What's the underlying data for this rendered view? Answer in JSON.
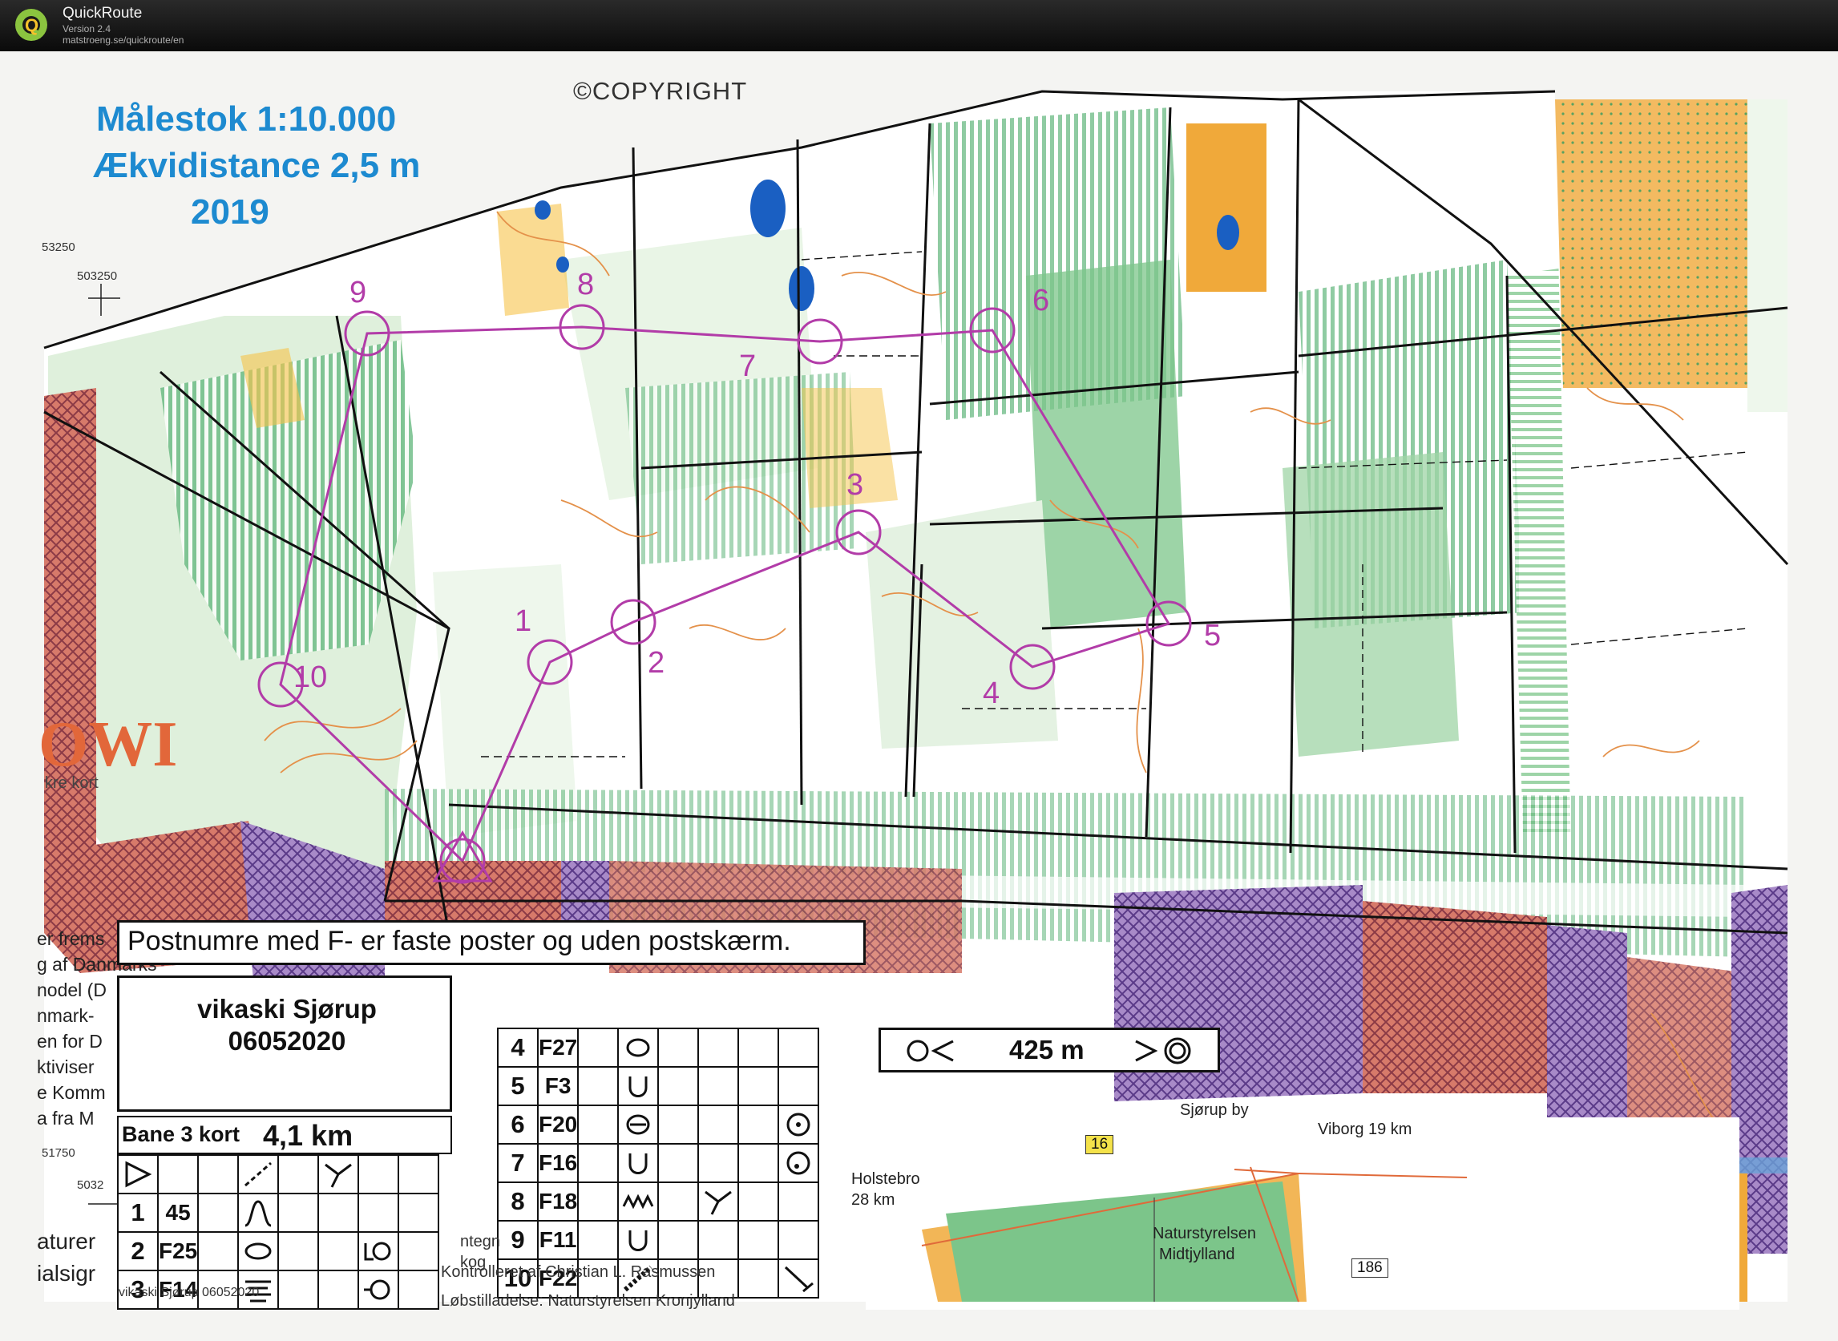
{
  "app": {
    "title": "QuickRoute",
    "version": "Version 2.4",
    "url": "matstroeng.se/quickroute/en"
  },
  "map": {
    "header": {
      "scale": "Målestok 1:10.000",
      "equidistance": "Ækvidistance 2,5 m",
      "year": "2019"
    },
    "copyright": "©COPYRIGHT",
    "coord_top_left_a": "53250",
    "coord_top_left_b": "503250",
    "coord_bottom_left_a": "51750",
    "coord_bottom_left_b": "5032",
    "owi_logo": "OWI",
    "owi_sub": "kre kort",
    "left_fragments": [
      "er frems",
      "g af Danmarks",
      "nodel (D",
      "nmark-",
      "en for D",
      "ktiviser",
      "e Komm",
      "a fra M"
    ],
    "bottom_fragments": [
      "aturer",
      "ialsigr"
    ],
    "notice": "Postnumre med F- er faste poster og uden postskærm.",
    "course": {
      "event_name": "vikaski Sjørup",
      "event_date": "06052020",
      "bane_label": "Bane 3 kort",
      "length": "4,1 km",
      "legs_distance": "425 m"
    },
    "controls_left": [
      {
        "num": "1",
        "code": "45",
        "symbol": "gully"
      },
      {
        "num": "2",
        "code": "F25",
        "symbol": "oval"
      },
      {
        "num": "3",
        "code": "F14",
        "symbol": "contour"
      }
    ],
    "controls_right": [
      {
        "num": "4",
        "code": "F27",
        "symbol": "oval"
      },
      {
        "num": "5",
        "code": "F3",
        "symbol": "cup"
      },
      {
        "num": "6",
        "code": "F20",
        "symbol": "theta"
      },
      {
        "num": "7",
        "code": "F16",
        "symbol": "cup"
      },
      {
        "num": "8",
        "code": "F18",
        "symbol": "zigzag"
      },
      {
        "num": "9",
        "code": "F11",
        "symbol": "cup"
      },
      {
        "num": "10",
        "code": "F22",
        "symbol": "hatch"
      }
    ],
    "inset": {
      "sjorup": "Sjørup by",
      "viborg": "Viborg 19 km",
      "holstebro": "Holstebro",
      "holstebro_km": "28 km",
      "nature": "Naturstyrelsen",
      "nature2": "Midtjylland",
      "road16": "16",
      "road186": "186"
    },
    "footnotes": {
      "f1": "vikaski Sjørup 06052020",
      "f2": "Kontrolleret af Christian L. Rasmussen",
      "f3": "Løbstilladelse: Naturstyrelsen Kronjylland",
      "f4": "ntegn",
      "f5": "kog"
    },
    "control_labels": [
      "1",
      "2",
      "3",
      "4",
      "5",
      "6",
      "7",
      "8",
      "9",
      "10"
    ],
    "colors": {
      "course": "#b23ca8",
      "forest_green": "#7cc58a",
      "light_green": "#bfe3bf",
      "yellow": "#f6c34a",
      "olive": "#c4a64a",
      "purple_hatch": "#7b4aa6",
      "red_hatch": "#c4473c",
      "water": "#1a5fc2",
      "contour": "#e4914a",
      "header_blue": "#1d8ad0"
    }
  }
}
